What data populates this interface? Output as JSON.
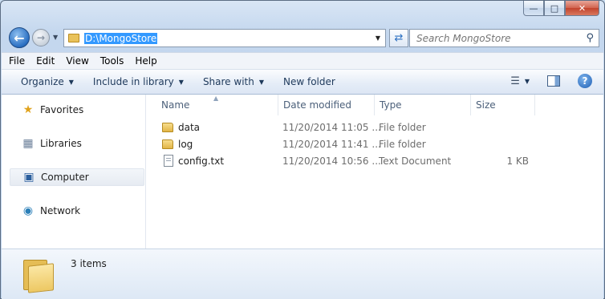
{
  "address": {
    "path": "D:\\MongoStore"
  },
  "search": {
    "placeholder": "Search MongoStore"
  },
  "menu": [
    "File",
    "Edit",
    "View",
    "Tools",
    "Help"
  ],
  "toolbar": {
    "organize": "Organize",
    "include_in_library": "Include in library",
    "share_with": "Share with",
    "new_folder": "New folder"
  },
  "nav": {
    "favorites": "Favorites",
    "libraries": "Libraries",
    "computer": "Computer",
    "network": "Network"
  },
  "columns": {
    "name": "Name",
    "date_modified": "Date modified",
    "type": "Type",
    "size": "Size"
  },
  "files": [
    {
      "name": "data",
      "date": "11/20/2014 11:05 ...",
      "type": "File folder",
      "size": "",
      "icon": "folder-icon"
    },
    {
      "name": "log",
      "date": "11/20/2014 11:41 ...",
      "type": "File folder",
      "size": "",
      "icon": "folder-icon"
    },
    {
      "name": "config.txt",
      "date": "11/20/2014 10:56 ...",
      "type": "Text Document",
      "size": "1 KB",
      "icon": "text-file-icon"
    }
  ],
  "details": {
    "count": "3 items"
  },
  "colors": {
    "selection": "#3399ff",
    "close_button": "#c2432d",
    "command_text": "#1e395b"
  }
}
